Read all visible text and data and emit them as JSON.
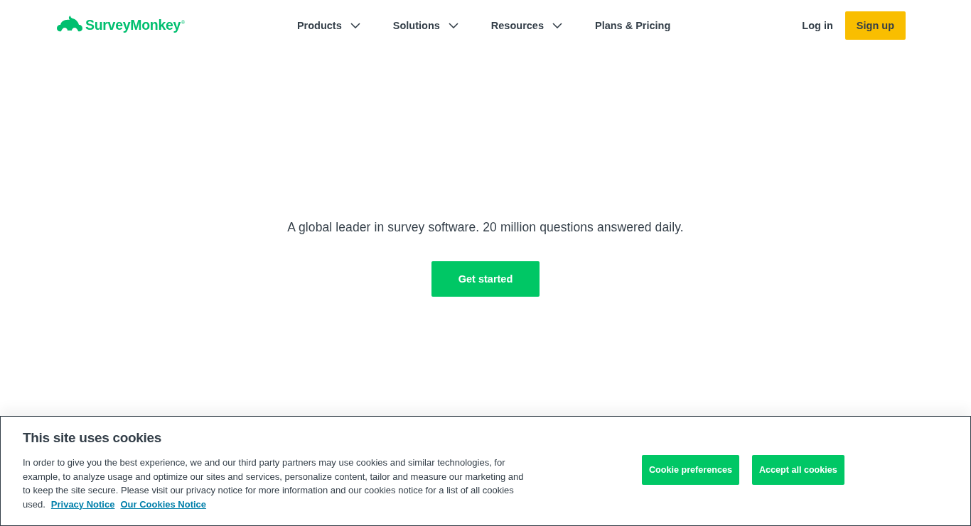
{
  "header": {
    "logo": {
      "text": "SurveyMonkey$^{®}$"
    },
    "nav": [
      {
        "label": "Products",
        "has_menu": true
      },
      {
        "label": "Solutions",
        "has_menu": true
      },
      {
        "label": "Resources",
        "has_menu": true
      },
      {
        "label": "Plans & Pricing",
        "has_menu": false
      }
    ],
    "login": "Log in",
    "signup": "Sign up"
  },
  "hero": {
    "tagline": "A global leader in survey software. 20 million questions answered daily.",
    "button": "Get started"
  },
  "cookie_banner": {
    "title": "This site uses cookies",
    "body": "In order to give you the best experience, we and our third party partners may use cookies and similar technologies, for example, to analyze usage and optimize our sites and services, personalize content, tailor and measure our marketing and to keep the site secure. Please visit our privacy notice for more information and our cookies notice for a list of all cookies used.",
    "links": [
      "Privacy Notice",
      "Our Cookies Notice"
    ],
    "buttons": [
      "Cookie preferences",
      "Accept all cookies"
    ]
  }
}
